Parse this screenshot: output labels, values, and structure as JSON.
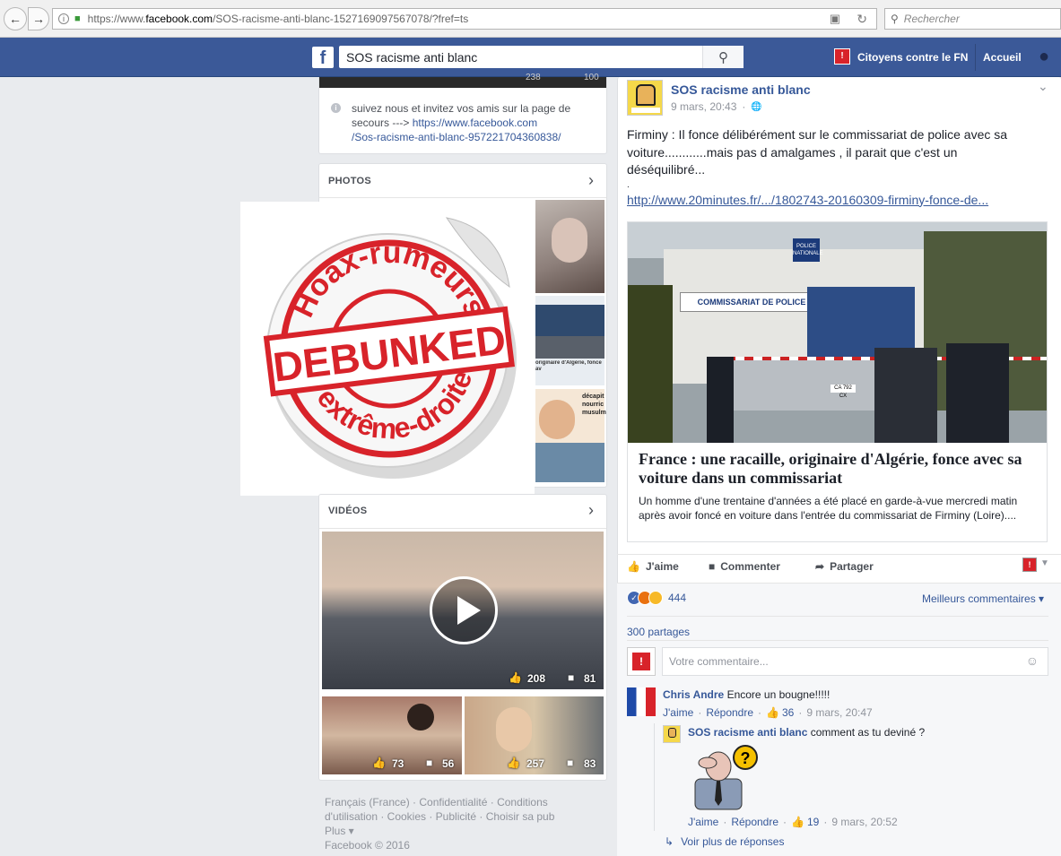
{
  "browser": {
    "url_prefix": "https://www.",
    "url_domain": "facebook.com",
    "url_path": "/SOS-racisme-anti-blanc-1527169097567078/?fref=ts",
    "search_placeholder": "Rechercher"
  },
  "fb_header": {
    "logo": "f",
    "search_value": "SOS racisme anti blanc",
    "profile_name": "Citoyens contre le FN",
    "home_label": "Accueil"
  },
  "left": {
    "top_stats": [
      "238",
      "100"
    ],
    "about_text": "suivez nous et invitez vos amis sur la page de secours ---> ",
    "about_link_1": "https://www.facebook.com",
    "about_link_2": "/Sos-racisme-anti-blanc-957221704360838/",
    "photos_title": "PHOTOS",
    "photo_caption_1": "originaire d'Algérie, fonce av",
    "photo_caption_2": "décapit",
    "photo_caption_3": "nourric",
    "photo_caption_4": "musulm",
    "videos_title": "VIDÉOS",
    "video_main_likes": "208",
    "video_main_comments": "81",
    "video_2_likes": "73",
    "video_2_comments": "56",
    "video_3_likes": "257",
    "video_3_comments": "83",
    "footer_1": "Français (France) · Confidentialité · Conditions",
    "footer_2": "d'utilisation · Cookies · Publicité · Choisir sa pub",
    "footer_3": "Plus",
    "footer_4": "Facebook © 2016"
  },
  "stamp": {
    "top": "Hoax-rumeurs",
    "middle": "DEBUNKED",
    "bottom": "d'extrême-droite"
  },
  "post": {
    "page_name": "SOS racisme anti blanc",
    "time": "9 mars, 20:43",
    "text_1": "Firminy : Il fonce délibérément sur le commissariat de police avec sa",
    "text_2": "voiture............mais pas d amalgames , il parait que c'est un",
    "text_3": "déséquilibré...",
    "dot": ".",
    "link": "http://www.20minutes.fr/.../1802743-20160309-firminy-fonce-de...",
    "img_sign_1": "COMMISSARIAT DE POLICE",
    "img_sign_2": "POLICE",
    "img_sign_3": "NATIONALE",
    "img_plate": "CA 792 CX",
    "article_title": "France : une racaille, originaire d'Algérie, fonce avec sa voiture dans un commissariat",
    "article_desc": "Un homme d'une trentaine d'années a été placé en garde-à-vue mercredi matin après avoir foncé en voiture dans l'entrée du commissariat de Firminy (Loire)....",
    "like_label": "J'aime",
    "comment_label": "Commenter",
    "share_label": "Partager",
    "reactions_count": "444",
    "best_comments": "Meilleurs commentaires",
    "shares": "300 partages",
    "comment_placeholder": "Votre commentaire..."
  },
  "comments": [
    {
      "author": "Chris Andre",
      "text": "Encore un bougne!!!!!",
      "like": "J'aime",
      "reply": "Répondre",
      "likes": "36",
      "time": "9 mars, 20:47"
    },
    {
      "author": "SOS racisme anti blanc",
      "text": "comment as tu deviné ?",
      "like": "J'aime",
      "reply": "Répondre",
      "likes": "19",
      "time": "9 mars, 20:52"
    }
  ],
  "more_replies": "Voir plus de réponses",
  "colors": {
    "fb_blue": "#3b5998",
    "link": "#365899",
    "stamp_red": "#d8232a",
    "bg": "#e9ebee"
  }
}
